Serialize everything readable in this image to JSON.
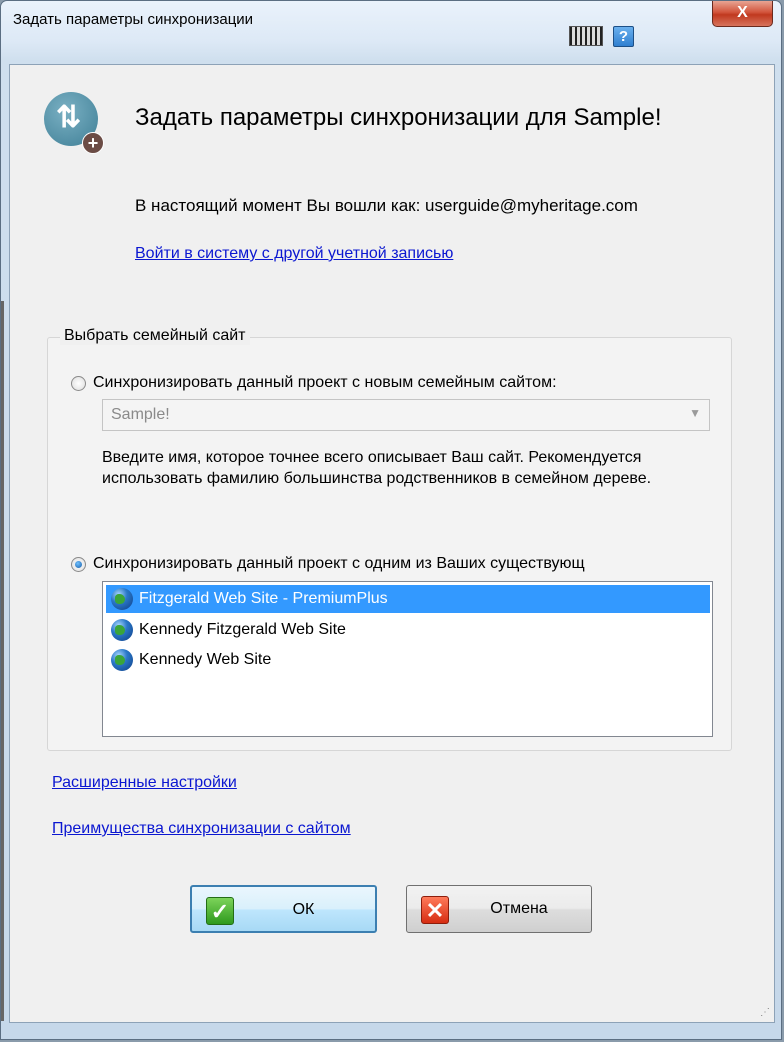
{
  "window": {
    "title": "Задать параметры синхронизации",
    "close_label": "X",
    "help_label": "?"
  },
  "header": {
    "heading": "Задать параметры синхронизации для Sample!",
    "logged_in_text": "В настоящий момент Вы вошли как: userguide@myheritage.com",
    "switch_account_link": "Войти в систему с другой учетной записью"
  },
  "family_site": {
    "group_label": "Выбрать семейный сайт",
    "new_site_option": "Синхронизировать данный проект с новым семейным сайтом:",
    "new_site_name_value": "Sample!",
    "hint": "Введите имя, которое точнее всего описывает Ваш сайт. Рекомендуется использовать фамилию большинства родственников в семейном дереве.",
    "existing_site_option": "Синхронизировать данный проект с одним из Ваших существующ",
    "selected_option": "existing",
    "sites": [
      {
        "label": "Fitzgerald Web Site - PremiumPlus",
        "selected": true
      },
      {
        "label": "Kennedy Fitzgerald Web Site",
        "selected": false
      },
      {
        "label": "Kennedy Web Site",
        "selected": false
      }
    ]
  },
  "links": {
    "advanced": "Расширенные настройки",
    "benefits": "Преимущества синхронизации с сайтом"
  },
  "buttons": {
    "ok": "ОК",
    "cancel": "Отмена"
  },
  "colors": {
    "link": "#0b17d1",
    "selection": "#3399ff",
    "ok_icon": "#2f9a1e",
    "cancel_icon": "#d62d12"
  },
  "icons": [
    "sync-add-icon",
    "keyboard-icon",
    "help-icon",
    "close-icon",
    "globe-icon",
    "checkmark-icon",
    "cross-icon"
  ]
}
